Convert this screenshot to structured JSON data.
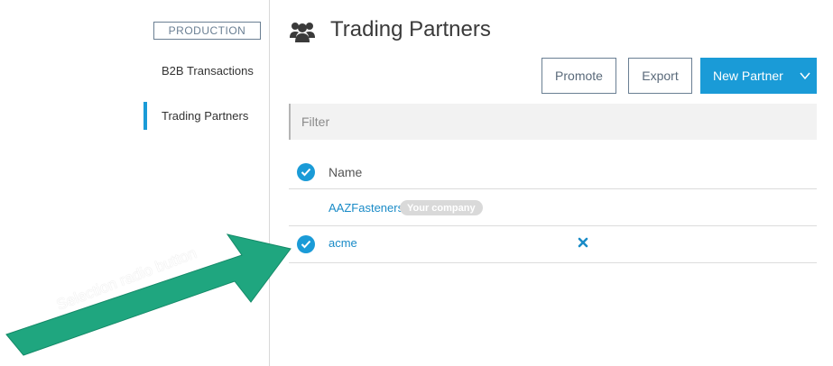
{
  "sidebar": {
    "environment": "PRODUCTION",
    "items": [
      {
        "label": "B2B Transactions"
      },
      {
        "label": "Trading Partners"
      }
    ]
  },
  "header": {
    "title": "Trading Partners",
    "icon": "users-group-icon"
  },
  "toolbar": {
    "promote_label": "Promote",
    "export_label": "Export",
    "new_partner_label": "New Partner"
  },
  "filter": {
    "placeholder": "Filter",
    "value": ""
  },
  "table": {
    "columns": [
      "Name"
    ],
    "rows": [
      {
        "name": "AAZFasteners",
        "badge": "Your company",
        "selected": false
      },
      {
        "name": "acme",
        "selected": true
      }
    ]
  },
  "annotation": {
    "text": "Selection radio button"
  },
  "colors": {
    "accent": "#1a9bd7",
    "link": "#1a8bc7",
    "annotation": "#1fa67f"
  }
}
